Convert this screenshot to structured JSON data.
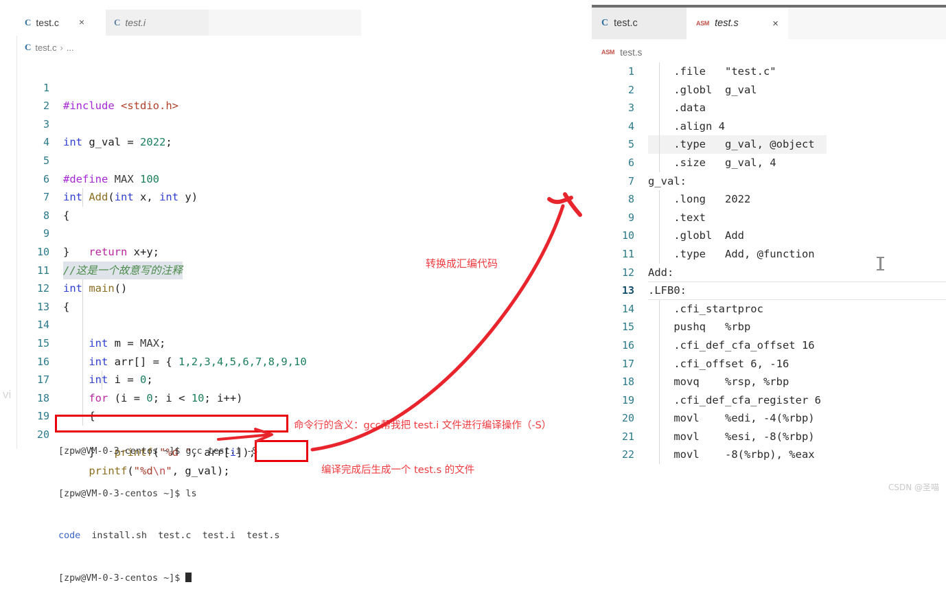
{
  "left_editor": {
    "tabs": [
      {
        "label": "test.c",
        "icon": "c-file-icon",
        "active": true,
        "has_close": true
      },
      {
        "label": "test.i",
        "icon": "c-file-icon",
        "active": false,
        "has_close": false
      }
    ],
    "close_glyph": "×",
    "breadcrumb": {
      "icon": "c-file-icon",
      "file": "test.c",
      "separator": "›",
      "trail": "..."
    },
    "lines": [
      {
        "n": "1",
        "text": "#include <stdio.h>"
      },
      {
        "n": "2",
        "text": ""
      },
      {
        "n": "3",
        "text": "int g_val = 2022;"
      },
      {
        "n": "4",
        "text": ""
      },
      {
        "n": "5",
        "text": "#define MAX 100"
      },
      {
        "n": "6",
        "text": "int Add(int x, int y)"
      },
      {
        "n": "7",
        "text": "{"
      },
      {
        "n": "8",
        "text": "    return x+y;"
      },
      {
        "n": "9",
        "text": "}"
      },
      {
        "n": "10",
        "text": "//这是一个故意写的注释"
      },
      {
        "n": "11",
        "text": "int main()"
      },
      {
        "n": "12",
        "text": "{"
      },
      {
        "n": "13",
        "text": "    int m = MAX;"
      },
      {
        "n": "14",
        "text": "    int arr[] = { 1,2,3,4,5,6,7,8,9,10"
      },
      {
        "n": "15",
        "text": "    int i = 0;"
      },
      {
        "n": "16",
        "text": "    for (i = 0; i < 10; i++)"
      },
      {
        "n": "17",
        "text": "    {"
      },
      {
        "n": "18",
        "text": "        printf(\"%d \", arr[i]);"
      },
      {
        "n": "19",
        "text": "    }"
      },
      {
        "n": "20",
        "text": "    printf(\"%d\\n\", g_val);"
      }
    ]
  },
  "terminal": {
    "lines": [
      "[zpw@VM-0-3-centos ~]$ gcc test.i -S",
      "[zpw@VM-0-3-centos ~]$ ls",
      "code  install.sh  test.c  test.i  test.s",
      "[zpw@VM-0-3-centos ~]$ "
    ],
    "prompt": "[zpw@VM-0-3-centos ~]$ ",
    "cmd1": "gcc test.i -S",
    "cmd2": "ls",
    "ls_code": "code",
    "ls_rest": "  install.sh  test.c  test.i  test.s"
  },
  "annotations": {
    "to_assembly": "转换成汇编代码",
    "command_meaning": "命令行的含义：gcc帮我把 test.i 文件进行编译操作（-S）",
    "generated_file": "编译完成后生成一个 test.s 的文件",
    "highlight_color": "#e8000d",
    "text_color": "#f03a3f"
  },
  "right_editor": {
    "tabs": [
      {
        "label": "test.c",
        "icon": "c-file-icon",
        "active": false,
        "has_close": false
      },
      {
        "label": "test.s",
        "icon": "asm-file-icon",
        "active": true,
        "has_close": true
      }
    ],
    "asm_icon_label": "ASM",
    "close_glyph": "×",
    "breadcrumb": {
      "icon": "asm-file-icon",
      "file": "test.s"
    },
    "lines": [
      {
        "n": "1",
        "text": "    .file   \"test.c\""
      },
      {
        "n": "2",
        "text": "    .globl  g_val"
      },
      {
        "n": "3",
        "text": "    .data"
      },
      {
        "n": "4",
        "text": "    .align 4"
      },
      {
        "n": "5",
        "text": "    .type   g_val, @object"
      },
      {
        "n": "6",
        "text": "    .size   g_val, 4"
      },
      {
        "n": "7",
        "text": "g_val:"
      },
      {
        "n": "8",
        "text": "    .long   2022"
      },
      {
        "n": "9",
        "text": "    .text"
      },
      {
        "n": "10",
        "text": "    .globl  Add"
      },
      {
        "n": "11",
        "text": "    .type   Add, @function"
      },
      {
        "n": "12",
        "text": "Add:"
      },
      {
        "n": "13",
        "text": ".LFB0:"
      },
      {
        "n": "14",
        "text": "    .cfi_startproc"
      },
      {
        "n": "15",
        "text": "    pushq   %rbp"
      },
      {
        "n": "16",
        "text": "    .cfi_def_cfa_offset 16"
      },
      {
        "n": "17",
        "text": "    .cfi_offset 6, -16"
      },
      {
        "n": "18",
        "text": "    movq    %rsp, %rbp"
      },
      {
        "n": "19",
        "text": "    .cfi_def_cfa_register 6"
      },
      {
        "n": "20",
        "text": "    movl    %edi, -4(%rbp)"
      },
      {
        "n": "21",
        "text": "    movl    %esi, -8(%rbp)"
      },
      {
        "n": "22",
        "text": "    movl    -8(%rbp), %eax"
      }
    ]
  },
  "watermarks": {
    "vi": "vi",
    "csdn": "CSDN @圣喵"
  }
}
